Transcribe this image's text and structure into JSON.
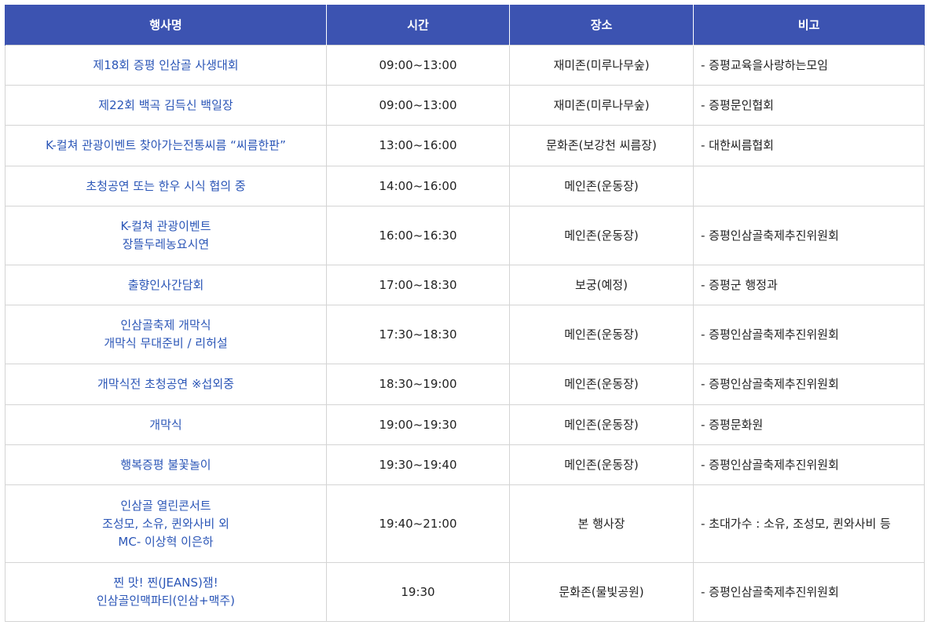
{
  "headers": [
    "행사명",
    "시간",
    "장소",
    "비고"
  ],
  "rows": [
    {
      "event": [
        "제18회 증평 인삼골 사생대회"
      ],
      "time": "09:00~13:00",
      "place": "재미존(미루나무숲)",
      "note": "- 증평교육을사랑하는모임"
    },
    {
      "event": [
        "제22회 백곡 김득신 백일장"
      ],
      "time": "09:00~13:00",
      "place": "재미존(미루나무숲)",
      "note": "- 증평문인협회"
    },
    {
      "event": [
        "K-컬쳐 관광이벤트 찾아가는전통씨름 “씨름한판”"
      ],
      "time": "13:00~16:00",
      "place": "문화존(보강천 씨름장)",
      "note": "- 대한씨름협회"
    },
    {
      "event": [
        "초청공연 또는 한우 시식 협의 중"
      ],
      "time": "14:00~16:00",
      "place": "메인존(운동장)",
      "note": ""
    },
    {
      "event": [
        "K-컬쳐 관광이벤트",
        "장뜰두레농요시연"
      ],
      "time": "16:00~16:30",
      "place": "메인존(운동장)",
      "note": "- 증평인삼골축제추진위원회"
    },
    {
      "event": [
        "출향인사간담회"
      ],
      "time": "17:00~18:30",
      "place": "보궁(예정)",
      "note": "- 증평군 행정과"
    },
    {
      "event": [
        "인삼골축제 개막식",
        "개막식 무대준비 / 리허설"
      ],
      "time": "17:30~18:30",
      "place": "메인존(운동장)",
      "note": "- 증평인삼골축제추진위원회"
    },
    {
      "event": [
        "개막식전 초청공연 ※섭외중"
      ],
      "time": "18:30~19:00",
      "place": "메인존(운동장)",
      "note": "- 증평인삼골축제추진위원회"
    },
    {
      "event": [
        "개막식"
      ],
      "time": "19:00~19:30",
      "place": "메인존(운동장)",
      "note": "- 증평문화원"
    },
    {
      "event": [
        "행복증평 불꽃놀이"
      ],
      "time": "19:30~19:40",
      "place": "메인존(운동장)",
      "note": "- 증평인삼골축제추진위원회"
    },
    {
      "event": [
        "인삼골 열린콘서트",
        "조성모, 소유, 퀸와사비 외",
        "MC- 이상혁 이은하"
      ],
      "time": "19:40~21:00",
      "place": "본 행사장",
      "note": "- 초대가수 : 소유, 조성모, 퀸와사비 등"
    },
    {
      "event": [
        "찐 맛! 찐(JEANS)잼!",
        "인삼골인맥파티(인삼+맥주)"
      ],
      "time": "19:30",
      "place": "문화존(물빛공원)",
      "note": "- 증평인삼골축제추진위원회"
    }
  ]
}
